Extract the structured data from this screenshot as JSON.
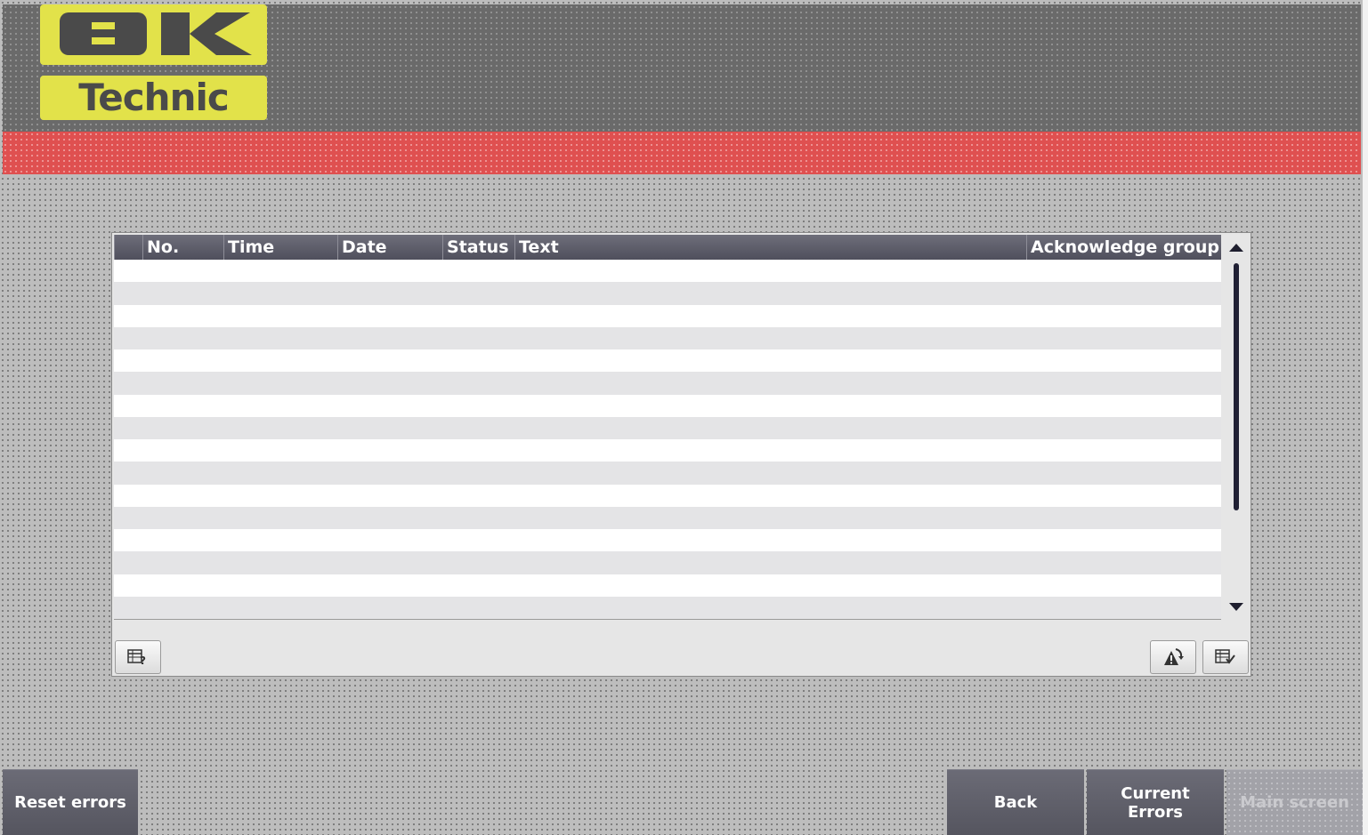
{
  "header": {
    "logo_top_text": "BK",
    "logo_bottom_text": "Technic",
    "colors": {
      "header_bg": "#6a6a6a",
      "accent_bar": "#df5050",
      "logo_yellow": "#e2e24a"
    }
  },
  "alarm_view": {
    "columns": [
      "No.",
      "Time",
      "Date",
      "Status",
      "Text",
      "Acknowledge group"
    ],
    "rows": [],
    "row_count_visible": 16,
    "toolbar": {
      "left_icon": "info-table-icon",
      "right_icons": [
        "acknowledge-alarm-icon",
        "edit-table-icon"
      ]
    }
  },
  "buttons": {
    "reset_errors": "Reset errors",
    "back": "Back",
    "current_errors_line1": "Current",
    "current_errors_line2": "Errors",
    "main_screen": "Main screen"
  }
}
